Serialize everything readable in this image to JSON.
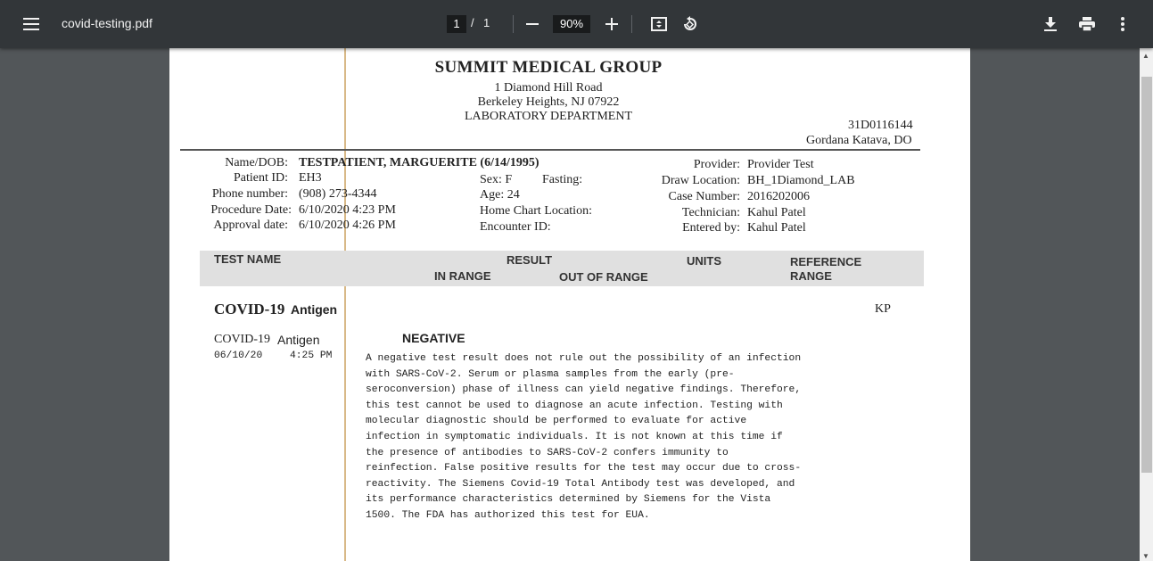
{
  "toolbar": {
    "title": "covid-testing.pdf",
    "current_page": "1",
    "separator": "/",
    "total_pages": "1",
    "zoom": "90%",
    "icons": [
      "menu-icon",
      "zoom-out-icon",
      "zoom-in-icon",
      "fit-page-icon",
      "rotate-icon",
      "download-icon",
      "print-icon",
      "more-vert-icon"
    ]
  },
  "document": {
    "org_name": "SUMMIT MEDICAL GROUP",
    "address1": "1 Diamond Hill Road",
    "address2": "Berkeley Heights, NJ  07922",
    "department": "LABORATORY DEPARTMENT",
    "clia": "31D0116144",
    "director": "Gordana Katava, DO",
    "patient": {
      "name_label": "Name/DOB:",
      "name_value": "TESTPATIENT, MARGUERITE  (6/14/1995)",
      "id_label": "Patient ID:",
      "id_value": "EH3",
      "phone_label": "Phone number:",
      "phone_value": "(908) 273-4344",
      "procedure_label": "Procedure Date:",
      "procedure_value": "6/10/2020 4:23 PM",
      "approval_label": "Approval date:",
      "approval_value": "6/10/2020 4:26 PM",
      "sex": "Sex: F",
      "fasting": "Fasting:",
      "age": "Age: 24",
      "home_chart": "Home Chart Location:",
      "encounter": "Encounter ID:",
      "provider_label": "Provider:",
      "provider_value": "Provider Test",
      "draw_label": "Draw Location:",
      "draw_value": "BH_1Diamond_LAB",
      "case_label": "Case Number:",
      "case_value": "2016202006",
      "tech_label": "Technician:",
      "tech_value": "Kahul Patel",
      "entered_label": "Entered by:",
      "entered_value": "Kahul Patel"
    },
    "table_header": {
      "test_name": "TEST NAME",
      "result": "RESULT",
      "in_range": "IN RANGE",
      "out_of_range": "OUT OF RANGE",
      "units": "UNITS",
      "reference": "REFERENCE",
      "range": "RANGE"
    },
    "test": {
      "title_main": "COVID-19",
      "title_sub": "Antigen",
      "initials": "KP",
      "name_main": "COVID-19",
      "name_sub": "Antigen",
      "date": "06/10/20",
      "time": "4:25 PM",
      "result": "NEGATIVE",
      "comment": "A negative test result does not rule out the possibility of an infection\nwith SARS-CoV-2. Serum or plasma samples from the early (pre-\nseroconversion) phase of illness can yield negative findings. Therefore,\nthis test cannot be used to diagnose an acute infection. Testing with\nmolecular diagnostic should be performed to evaluate for active\ninfection in symptomatic individuals. It is not known at this time if\nthe presence of antibodies to SARS-CoV-2 confers immunity to\nreinfection. False positive results for the test may occur due to cross-\nreactivity. The Siemens Covid-19 Total Antibody test was developed, and\nits performance characteristics determined by Siemens for the Vista\n1500. The FDA has authorized this test for EUA."
    }
  }
}
